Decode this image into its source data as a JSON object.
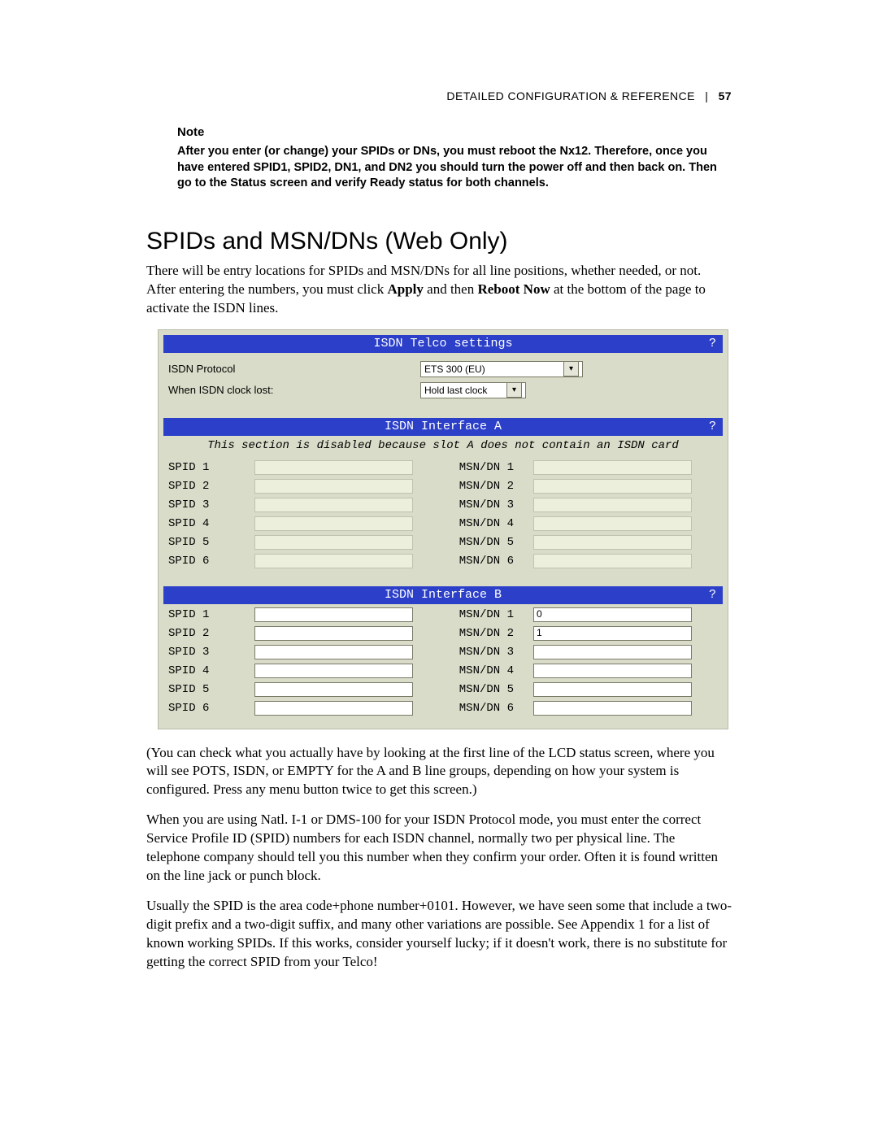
{
  "header": {
    "title": "DETAILED CONFIGURATION & REFERENCE",
    "page": "57",
    "sep": "|"
  },
  "note": {
    "label": "Note",
    "body": "After you enter (or change) your SPIDs or DNs, you must reboot the Nx12. Therefore, once you have entered SPID1, SPID2, DN1, and DN2 you should turn the power off and then back on. Then go to the Status screen and verify Ready status for both channels."
  },
  "section_title": "SPIDs and MSN/DNs (Web Only)",
  "intro_pre": "There will be entry locations for SPIDs and MSN/DNs for all line positions, whether needed, or not. After entering the numbers, you must click ",
  "intro_apply": "Apply",
  "intro_mid": " and then ",
  "intro_reboot": "Reboot Now",
  "intro_post": " at the bottom of the page to activate the ISDN lines.",
  "panel": {
    "telco_bar": "ISDN Telco settings",
    "help": "?",
    "proto_label": "ISDN Protocol",
    "proto_value": "ETS 300 (EU)",
    "clock_label": "When ISDN clock lost:",
    "clock_value": "Hold last clock",
    "ifa_bar": "ISDN Interface A",
    "ifa_disabled_msg": "This section is disabled because slot A does not contain an ISDN card",
    "ifb_bar": "ISDN Interface B",
    "rows": [
      {
        "spid": "SPID 1",
        "msn": "MSN/DN 1"
      },
      {
        "spid": "SPID 2",
        "msn": "MSN/DN 2"
      },
      {
        "spid": "SPID 3",
        "msn": "MSN/DN 3"
      },
      {
        "spid": "SPID 4",
        "msn": "MSN/DN 4"
      },
      {
        "spid": "SPID 5",
        "msn": "MSN/DN 5"
      },
      {
        "spid": "SPID 6",
        "msn": "MSN/DN 6"
      }
    ],
    "ifb_msn_values": [
      "0",
      "1",
      "",
      "",
      "",
      ""
    ]
  },
  "para_check": "(You can check what you actually have by looking at the first line of the LCD status screen, where you will see POTS, ISDN, or EMPTY for the A and B line groups, depending on how your system is configured. Press any menu button twice to get this screen.)",
  "para_spid1": "When you are using Natl. I-1 or DMS-100 for your ISDN Protocol mode, you must enter the correct Service Profile ID (SPID) numbers for each ISDN channel, normally two per physical line. The telephone company should tell you this number when they confirm your order. Often it is found written on the line jack or punch block.",
  "para_spid2": "Usually the SPID is the area code+phone number+0101. However, we have seen some that include a two-digit prefix and a two-digit suffix, and many other variations are possible. See Appendix 1 for a list of known working SPIDs. If this works, consider yourself lucky; if it doesn't work, there is no substitute for getting the correct SPID from your Telco!"
}
